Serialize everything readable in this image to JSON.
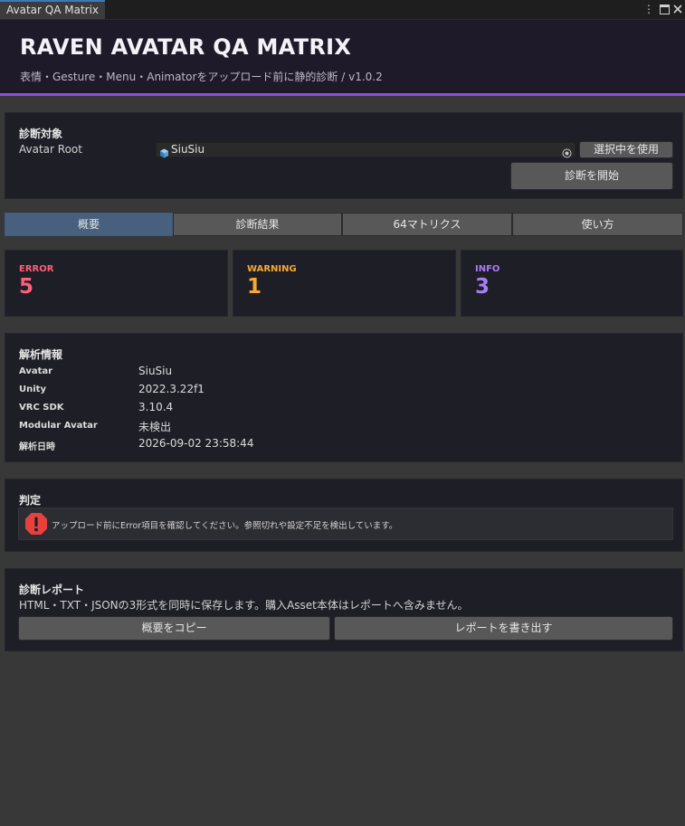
{
  "window": {
    "tab_title": "Avatar QA Matrix"
  },
  "header": {
    "title": "RAVEN AVATAR QA MATRIX",
    "subtitle": "表情・Gesture・Menu・Animatorをアップロード前に静的診断 / v1.0.2"
  },
  "target": {
    "section_title": "診断対象",
    "root_label": "Avatar Root",
    "root_value": "SiuSiu",
    "use_selected_label": "選択中を使用",
    "start_label": "診断を開始"
  },
  "tabs": [
    {
      "label": "概要",
      "active": true
    },
    {
      "label": "診断結果",
      "active": false
    },
    {
      "label": "64マトリクス",
      "active": false
    },
    {
      "label": "使い方",
      "active": false
    }
  ],
  "summary": {
    "error": {
      "label": "ERROR",
      "count": "5",
      "color": "#ff5f78"
    },
    "warning": {
      "label": "WARNING",
      "count": "1",
      "color": "#f5aa33"
    },
    "info": {
      "label": "INFO",
      "count": "3",
      "color": "#a87ef5"
    }
  },
  "analysis": {
    "section_title": "解析情報",
    "rows": [
      {
        "key": "Avatar",
        "value": "SiuSiu"
      },
      {
        "key": "Unity",
        "value": "2022.3.22f1"
      },
      {
        "key": "VRC SDK",
        "value": "3.10.4"
      },
      {
        "key": "Modular Avatar",
        "value": "未検出"
      },
      {
        "key": "解析日時",
        "value": "2026-09-02 23:58:44"
      }
    ]
  },
  "verdict": {
    "section_title": "判定",
    "message": "アップロード前にError項目を確認してください。参照切れや設定不足を検出しています。",
    "color": "#e8413d"
  },
  "report": {
    "section_title": "診断レポート",
    "description": "HTML・TXT・JSONの3形式を同時に保存します。購入Asset本体はレポートへ含みません。",
    "copy_label": "概要をコピー",
    "export_label": "レポートを書き出す"
  }
}
